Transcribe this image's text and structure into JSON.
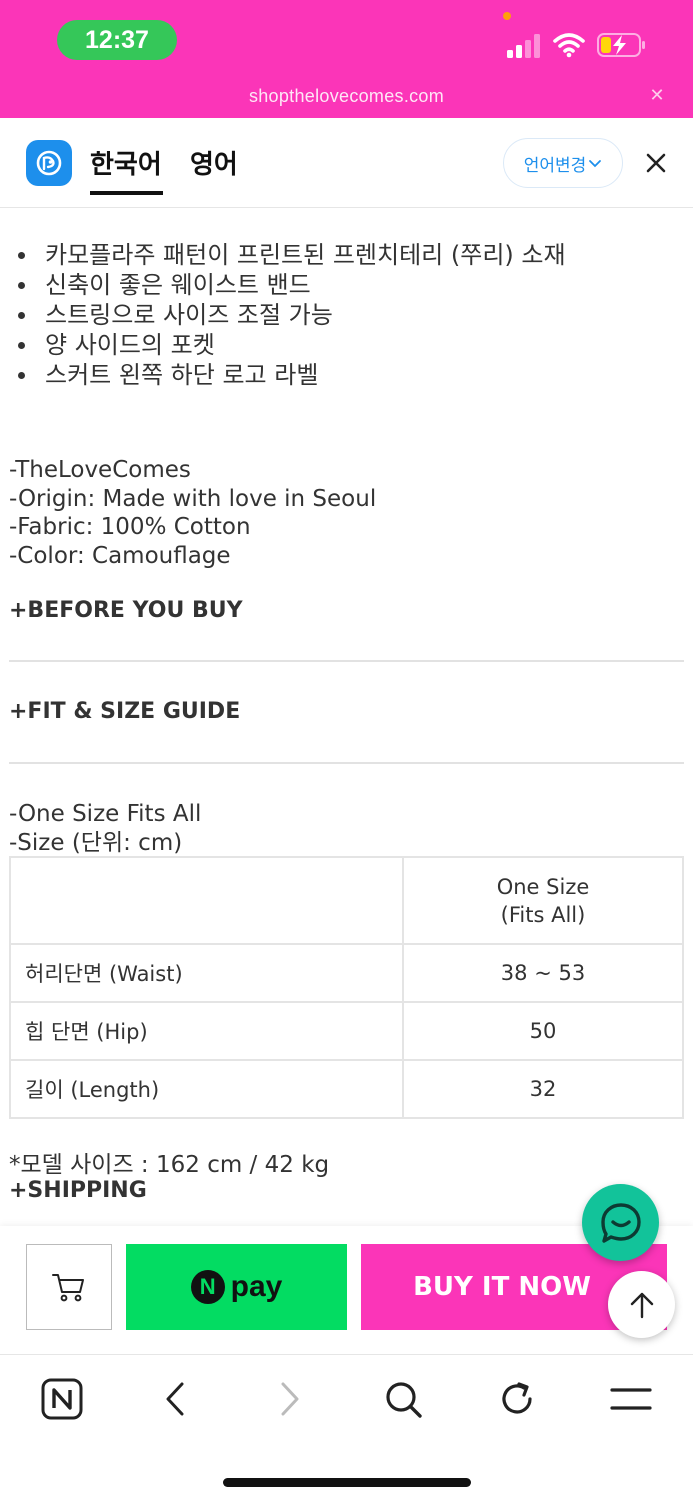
{
  "status_bar": {
    "time": "12:37",
    "url": "shopthelovecomes.com",
    "bg_color": "#fb35b8"
  },
  "translate_bar": {
    "logo_icon": "papago-logo-icon",
    "tabs": [
      {
        "label": "한국어",
        "active": true
      },
      {
        "label": "영어",
        "active": false
      }
    ],
    "change_button": "언어변경",
    "close_icon": "close-icon"
  },
  "product": {
    "bullets": [
      "카모플라주 패턴이 프린트된 프렌치테리 (쭈리) 소재",
      "신축이 좋은 웨이스트 밴드",
      "스트링으로 사이즈 조절 가능",
      "양 사이드의 포켓",
      "스커트 왼쪽 하단 로고 라벨"
    ],
    "meta": [
      "-TheLoveComes",
      "-Origin: Made with love in Seoul",
      "-Fabric: 100% Cotton",
      "-Color: Camouflage"
    ],
    "before_you_buy": "+BEFORE YOU BUY",
    "fit_size_guide": "+FIT & SIZE GUIDE",
    "size_lines": [
      "-One Size Fits All",
      "-Size (단위: cm)"
    ],
    "size_table": {
      "header": [
        "",
        "One Size",
        "(Fits All)"
      ],
      "rows": [
        {
          "label": "허리단면 (Waist)",
          "value": "38 ~ 53"
        },
        {
          "label": "힙 단면 (Hip)",
          "value": "50"
        },
        {
          "label": "길이 (Length)",
          "value": "32"
        }
      ]
    },
    "model_size": "*모델 사이즈 :  162 cm / 42 kg",
    "shipping": "+SHIPPING"
  },
  "buy_bar": {
    "cart_icon": "cart-icon",
    "npay_n": "N",
    "npay_label": "pay",
    "buy_now_label": "BUY IT NOW",
    "buy_color": "#fb35b8",
    "npay_color": "#03dc62"
  },
  "floating": {
    "chat_icon": "chat-icon",
    "scroll_top_icon": "arrow-up-icon",
    "chat_color": "#12c39a"
  },
  "browser_toolbar": {
    "items": [
      "naver-home-icon",
      "back-icon",
      "forward-icon",
      "search-icon",
      "refresh-icon",
      "menu-icon"
    ]
  }
}
